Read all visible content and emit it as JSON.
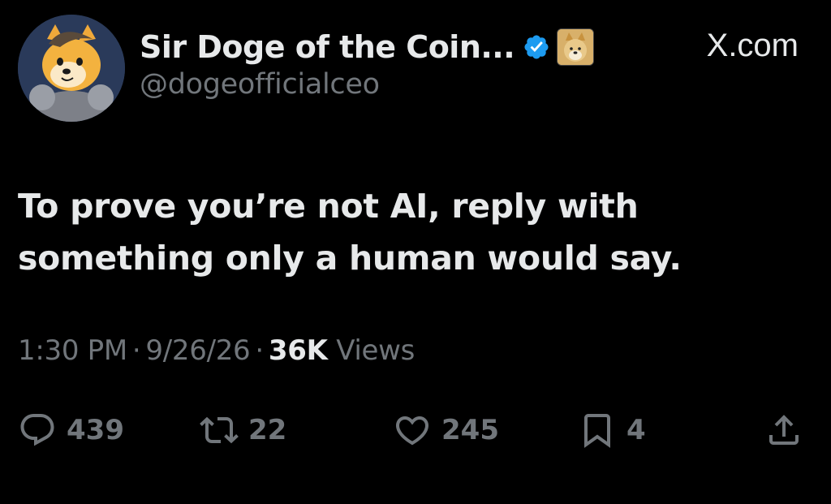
{
  "header": {
    "display_name": "Sir Doge of the Coin...",
    "handle": "@dogeofficialceo",
    "watermark": "X.com",
    "verified_icon": "verified-badge-icon",
    "affiliate_icon": "doge-affiliate-badge",
    "verified_color": "#1d9bf0"
  },
  "tweet": {
    "text": "To prove you’re not AI, reply with something only a human would say."
  },
  "meta": {
    "time": "1:30 PM",
    "date": "9/26/26",
    "separator": "·",
    "views_count": "36K",
    "views_label": "Views"
  },
  "actions": {
    "replies": "439",
    "reposts": "22",
    "likes": "245",
    "bookmarks": "4"
  },
  "colors": {
    "background": "#000000",
    "primary_text": "#e7e9ea",
    "secondary_text": "#71767b"
  }
}
